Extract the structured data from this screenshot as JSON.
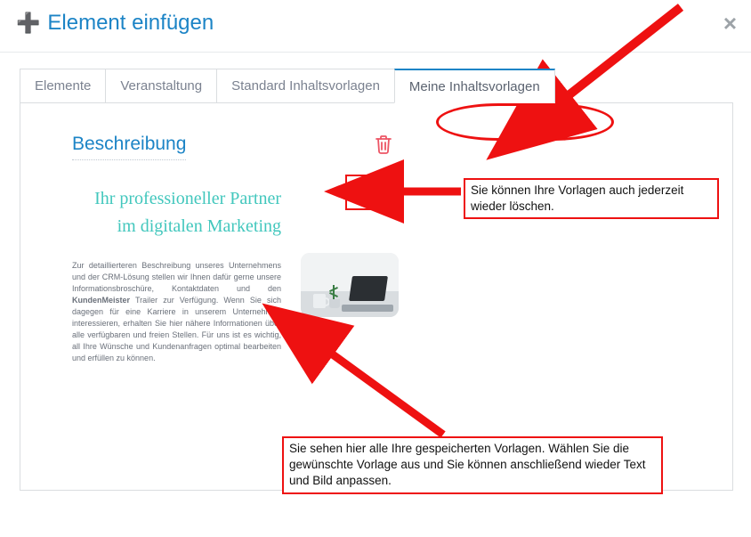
{
  "header": {
    "title": "Element einfügen"
  },
  "tabs": [
    {
      "id": "elemente",
      "label": "Elemente",
      "active": false
    },
    {
      "id": "veranstaltung",
      "label": "Veranstaltung",
      "active": false
    },
    {
      "id": "standard",
      "label": "Standard Inhaltsvorlagen",
      "active": false
    },
    {
      "id": "meine",
      "label": "Meine Inhaltsvorlagen",
      "active": true
    }
  ],
  "panel": {
    "heading": "Beschreibung",
    "subheadline": "Ihr professioneller Partner im digitalen Marketing",
    "body_html": "Zur detaillierteren Beschreibung unseres Unternehmens und der CRM-Lösung stellen wir Ihnen dafür gerne unsere Informationsbroschüre, Kontaktdaten und den <b>KundenMeister</b> Trailer zur Verfügung. Wenn Sie sich dagegen für eine Karriere in unserem Unternehmen interessieren, erhalten Sie hier nähere Informationen über alle verfügbaren und freien Stellen. Für uns ist es wichtig, all Ihre Wünsche und Kundenanfragen optimal bearbeiten und erfüllen zu können."
  },
  "annotations": {
    "delete_hint": "Sie können Ihre Vorlagen auch jederzeit wieder löschen.",
    "templates_hint": "Sie sehen hier alle Ihre gespeicherten Vorlagen. Wählen Sie die gewünschte Vorlage aus und Sie können anschließend wieder Text und Bild anpassen."
  },
  "icons": {
    "trash": "trash-icon",
    "close": "close-icon",
    "plus": "plus-icon"
  }
}
